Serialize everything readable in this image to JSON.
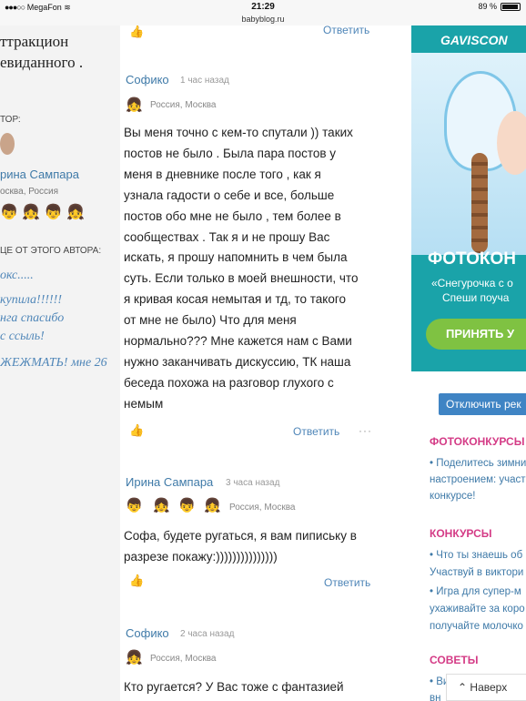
{
  "status_bar": {
    "carrier": "MegaFon",
    "time": "21:29",
    "battery": "89 %",
    "url": "babyblog.ru"
  },
  "left_column": {
    "title_line1": "ттракцион",
    "title_line2": "евиданного .",
    "author_label": "ТОР:",
    "author_name": "рина Сампара",
    "author_location": "осква, Россия",
    "more_label": "ЦЕ ОТ ЭТОГО АВТОРА:",
    "posts": [
      "окс.....",
      "купила!!!!!!",
      "нга спасибо",
      "с ссыль!",
      "ЖЕЖМАТЬ! мне 26"
    ]
  },
  "main": {
    "top_reply_label": "Ответить",
    "comments": [
      {
        "author": "Софико",
        "time": "1 час назад",
        "location": "Россия, Москва",
        "lines": [
          "Вы меня точно с кем-то спутали )) таких",
          "постов не было . Была пара постов у",
          "меня в дневнике после того , как я",
          "узнала гадости о себе и все, больше",
          "постов обо мне не было , тем более в",
          "сообществах . Так я и не прошу Вас",
          "искать, я прошу напомнить в чем была",
          "суть. Если только в моей внешности, что",
          "я кривая косая немытая и тд, то такого",
          "от мне не было) Что для меня",
          "нормально??? Мне кажется нам с Вами",
          "нужно заканчивать дискуссию, ТК наша",
          "беседа похожа на разговор глухого с",
          "немым"
        ],
        "reply_label": "Ответить",
        "more_label": "···"
      },
      {
        "author": "Ирина Сампара",
        "time": "3 часа назад",
        "location": "Россия, Москва",
        "lines": [
          "Софа, будете ругаться, я вам пипиську в",
          "разрезе покажу:)))))))))))))))"
        ],
        "reply_label": "Ответить"
      },
      {
        "author": "Софико",
        "time": "2 часа назад",
        "location": "Россия, Москва",
        "lines": [
          "Кто ругается? У Вас тоже с фантазией"
        ]
      }
    ]
  },
  "right_column": {
    "ad": {
      "brand": "GAVISCON",
      "headline": "ФОТОКОН",
      "sub1": "«Снегурочка с о",
      "sub2": "Спеши поуча",
      "cta": "ПРИНЯТЬ У"
    },
    "disable_ads": "Отключить рек",
    "sections": [
      {
        "title": "ФОТОКОНКУРСЫ",
        "links": [
          "• Поделитесь зимни",
          "настроением: участ",
          "конкурсе!"
        ]
      },
      {
        "title": "КОНКУРСЫ",
        "links": [
          "• Что ты знаешь об",
          "Участвуй в виктори",
          "• Игра для супер-м",
          "ухаживайте за коро",
          "получайте молочко"
        ]
      },
      {
        "title": "СОВЕТЫ",
        "links": [
          "• Ви",
          "вн"
        ]
      }
    ],
    "back_label": "Наверх"
  }
}
